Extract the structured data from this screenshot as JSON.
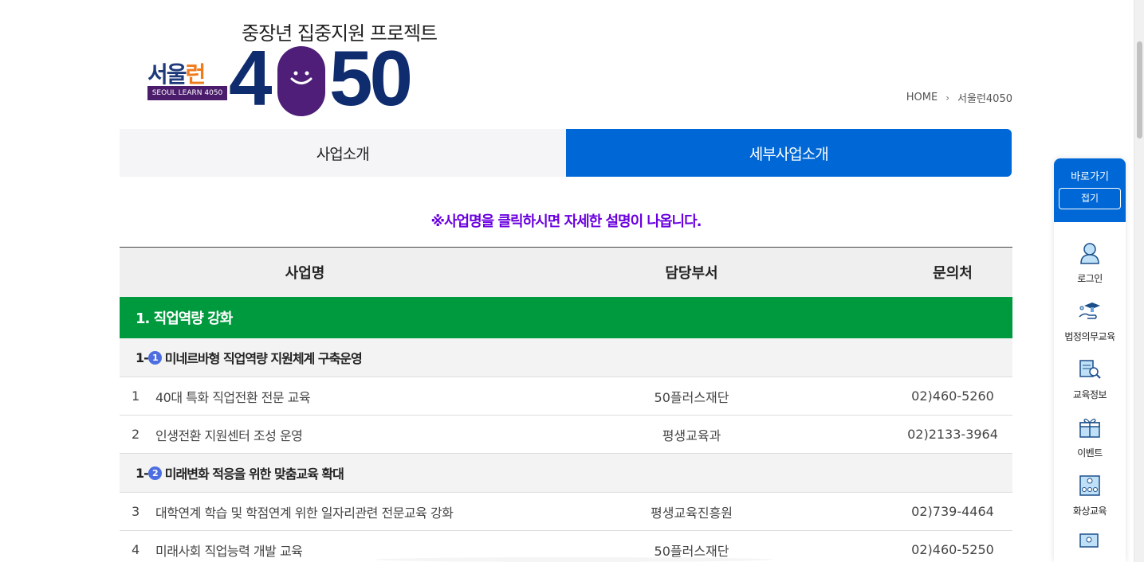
{
  "logo": {
    "tagline": "중장년 집중지원 프로젝트",
    "brand_a": "서울",
    "brand_b": "런",
    "sub": "SEOUL LEARN 4050",
    "num_4": "4",
    "num_50": "50"
  },
  "breadcrumb": {
    "home": "HOME",
    "current": "서울런4050"
  },
  "tabs": [
    {
      "label": "사업소개"
    },
    {
      "label": "세부사업소개"
    }
  ],
  "notice": "※사업명을 클릭하시면 자세한 설명이 나옵니다.",
  "table": {
    "headers": [
      "사업명",
      "담당부서",
      "문의처"
    ],
    "section_1": "1. 직업역량 강화",
    "sub_1": {
      "prefix": "1-",
      "badge": "1",
      "title": "미네르바형 직업역량 지원체계 구축운영"
    },
    "sub_2": {
      "prefix": "1-",
      "badge": "2",
      "title": "미래변화 적응을 위한 맞춤교육 확대"
    },
    "rows": [
      {
        "no": "1",
        "name": "40대 특화 직업전환 전문 교육",
        "dept": "50플러스재단",
        "tel": "02)460-5260"
      },
      {
        "no": "2",
        "name": "인생전환 지원센터 조성 운영",
        "dept": "평생교육과",
        "tel": "02)2133-3964"
      },
      {
        "no": "3",
        "name": "대학연계 학습 및 학점연계 위한 일자리관련 전문교육 강화",
        "dept": "평생교육진흥원",
        "tel": "02)739-4464"
      },
      {
        "no": "4",
        "name": "미래사회 직업능력 개발 교육",
        "dept": "50플러스재단",
        "tel": "02)460-5250"
      }
    ]
  },
  "quick": {
    "title": "바로가기",
    "fold": "접기",
    "items": [
      {
        "label": "로그인",
        "icon": "user-icon"
      },
      {
        "label": "법정의무교육",
        "icon": "graduation-hand-icon"
      },
      {
        "label": "교육정보",
        "icon": "education-info-icon"
      },
      {
        "label": "이벤트",
        "icon": "gift-icon"
      },
      {
        "label": "화상교육",
        "icon": "video-class-icon"
      },
      {
        "label": "",
        "icon": "monitor-user-icon"
      }
    ]
  },
  "colors": {
    "primary": "#0068d6",
    "section_green": "#009a3e",
    "notice_purple": "#6a00e0",
    "badge_blue": "#4d6ee0"
  }
}
